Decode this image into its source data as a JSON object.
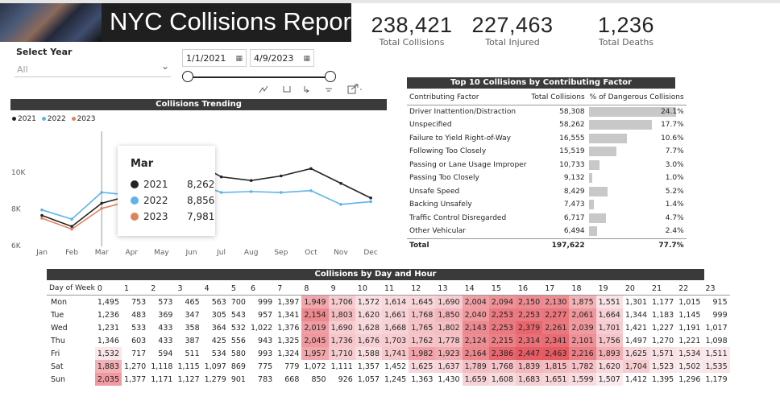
{
  "header": {
    "title": "NYC Collisions Report"
  },
  "kpis": [
    {
      "value": "238,421",
      "label": "Total Collisions"
    },
    {
      "value": "227,463",
      "label": "Total Injured"
    },
    {
      "value": "1,236",
      "label": "Total Deaths"
    }
  ],
  "year_slicer": {
    "title": "Select Year",
    "value": "All"
  },
  "date_slicer": {
    "start": "1/1/2021",
    "end": "4/9/2023"
  },
  "trend": {
    "title": "Collisions Trending",
    "tooltip": {
      "title": "Mar",
      "rows": [
        {
          "name": "2021",
          "value": "8,262",
          "color": "#252423"
        },
        {
          "name": "2022",
          "value": "8,856",
          "color": "#5fb3ec"
        },
        {
          "name": "2023",
          "value": "7,981",
          "color": "#e0835d"
        }
      ]
    }
  },
  "chart_data": {
    "type": "line",
    "title": "Collisions Trending",
    "categories": [
      "Jan",
      "Feb",
      "Mar",
      "Apr",
      "May",
      "Jun",
      "Jul",
      "Aug",
      "Sep",
      "Oct",
      "Nov",
      "Dec"
    ],
    "y_ticks": [
      "10K",
      "8K",
      "6K"
    ],
    "ylim": [
      6000,
      11000
    ],
    "legend": "top-left",
    "series": [
      {
        "name": "2021",
        "color": "#252423",
        "values": [
          7600,
          7000,
          8262,
          8700,
          10350,
          10600,
          9700,
          9500,
          9750,
          10150,
          9350,
          8550
        ]
      },
      {
        "name": "2022",
        "color": "#5fb3ec",
        "values": [
          7900,
          7400,
          8856,
          8700,
          8900,
          9450,
          8850,
          8900,
          8850,
          8950,
          8200,
          8350
        ]
      },
      {
        "name": "2023",
        "color": "#e0835d",
        "values": [
          7450,
          6850,
          7981,
          8400
        ]
      }
    ]
  },
  "top10": {
    "title": "Top 10 Collisions by Contributing Factor",
    "columns": [
      "Contributing Factor",
      "Total Collisions",
      "% of Dangerous Collisions"
    ],
    "rows": [
      {
        "factor": "Driver Inattention/Distraction",
        "total": "58,308",
        "pct": "24.1%",
        "bar": 1.0
      },
      {
        "factor": "Unspecified",
        "total": "58,262",
        "pct": "17.7%",
        "bar": 0.73
      },
      {
        "factor": "Failure to Yield Right-of-Way",
        "total": "16,555",
        "pct": "10.6%",
        "bar": 0.44
      },
      {
        "factor": "Following Too Closely",
        "total": "15,519",
        "pct": "7.7%",
        "bar": 0.32
      },
      {
        "factor": "Passing or Lane Usage Improper",
        "total": "10,733",
        "pct": "3.0%",
        "bar": 0.125
      },
      {
        "factor": "Passing Too Closely",
        "total": "9,132",
        "pct": "1.0%",
        "bar": 0.04
      },
      {
        "factor": "Unsafe Speed",
        "total": "8,429",
        "pct": "5.2%",
        "bar": 0.215
      },
      {
        "factor": "Backing Unsafely",
        "total": "7,473",
        "pct": "1.4%",
        "bar": 0.06
      },
      {
        "factor": "Traffic Control Disregarded",
        "total": "6,717",
        "pct": "4.7%",
        "bar": 0.195
      },
      {
        "factor": "Other Vehicular",
        "total": "6,494",
        "pct": "2.4%",
        "bar": 0.1
      }
    ],
    "total": {
      "label": "Total",
      "total": "197,622",
      "pct": "77.7%"
    }
  },
  "heatmap": {
    "title": "Collisions by Day and Hour",
    "corner": "Day of Week",
    "hours": [
      "0",
      "1",
      "2",
      "3",
      "4",
      "5",
      "6",
      "7",
      "8",
      "9",
      "10",
      "11",
      "12",
      "13",
      "14",
      "15",
      "16",
      "17",
      "18",
      "19",
      "20",
      "21",
      "22",
      "23"
    ],
    "days": [
      {
        "day": "Mon",
        "values": [
          1495,
          753,
          573,
          465,
          563,
          700,
          999,
          1397,
          1949,
          1706,
          1572,
          1614,
          1645,
          1690,
          2004,
          2094,
          2150,
          2130,
          1875,
          1551,
          1301,
          1177,
          1015,
          915
        ]
      },
      {
        "day": "Tue",
        "values": [
          1236,
          483,
          369,
          347,
          305,
          543,
          957,
          1341,
          2154,
          1803,
          1620,
          1661,
          1768,
          1850,
          2040,
          2253,
          2253,
          2277,
          2061,
          1664,
          1344,
          1183,
          1145,
          999
        ]
      },
      {
        "day": "Wed",
        "values": [
          1231,
          533,
          433,
          358,
          364,
          532,
          1022,
          1376,
          2019,
          1690,
          1628,
          1668,
          1765,
          1802,
          2143,
          2253,
          2379,
          2261,
          2039,
          1701,
          1421,
          1227,
          1191,
          1017
        ]
      },
      {
        "day": "Thu",
        "values": [
          1346,
          603,
          433,
          387,
          425,
          556,
          943,
          1325,
          2045,
          1736,
          1676,
          1703,
          1762,
          1778,
          2124,
          2215,
          2314,
          2341,
          2101,
          1756,
          1497,
          1270,
          1221,
          1098
        ]
      },
      {
        "day": "Fri",
        "values": [
          1532,
          717,
          594,
          511,
          534,
          580,
          993,
          1324,
          1957,
          1710,
          1588,
          1741,
          1982,
          1923,
          2164,
          2386,
          2447,
          2463,
          2216,
          1893,
          1625,
          1571,
          1534,
          1511
        ]
      },
      {
        "day": "Sat",
        "values": [
          1883,
          1270,
          1118,
          1115,
          1097,
          869,
          775,
          779,
          1072,
          1111,
          1357,
          1452,
          1625,
          1637,
          1789,
          1768,
          1839,
          1815,
          1782,
          1620,
          1704,
          1523,
          1502,
          1535
        ]
      },
      {
        "day": "Sun",
        "values": [
          2035,
          1377,
          1171,
          1127,
          1279,
          901,
          783,
          668,
          850,
          926,
          1057,
          1245,
          1363,
          1430,
          1659,
          1608,
          1683,
          1651,
          1599,
          1507,
          1412,
          1395,
          1296,
          1179
        ]
      }
    ]
  }
}
